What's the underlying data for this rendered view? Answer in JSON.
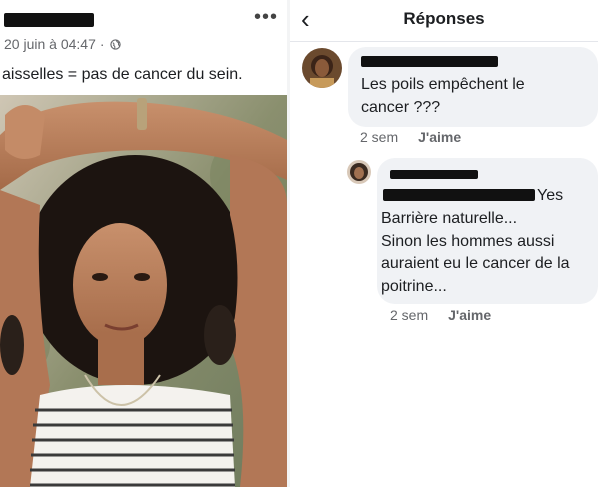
{
  "post": {
    "timestamp": "20 juin à 04:47",
    "separator": "·",
    "caption": "aisselles = pas de cancer du sein.",
    "more_icon": "more-horizontal-icon",
    "privacy_icon": "globe-icon"
  },
  "replies": {
    "title": "Réponses",
    "back_icon": "chevron-left-icon"
  },
  "comments": [
    {
      "lines": [
        "Les poils empêchent le",
        "cancer ???"
      ],
      "time": "2 sem",
      "like": "J'aime"
    },
    {
      "first_line_visible": "Yes",
      "lines": [
        "Barrière naturelle...",
        "Sinon les hommes aussi",
        "auraient eu le cancer de la",
        "poitrine..."
      ],
      "time": "2 sem",
      "like": "J'aime"
    }
  ],
  "colors": {
    "bubble": "#f0f2f5",
    "meta_text": "#65676b",
    "redaction": "#111111"
  }
}
